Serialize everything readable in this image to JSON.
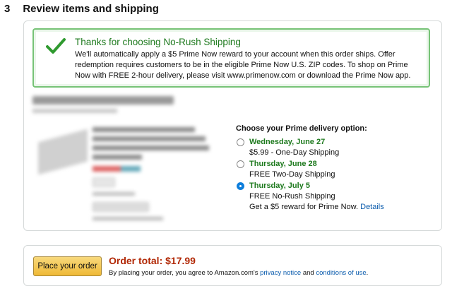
{
  "step": {
    "number": "3",
    "title": "Review items and shipping"
  },
  "alert": {
    "icon": "checkmark-icon",
    "title": "Thanks for choosing No-Rush Shipping",
    "body": "We'll automatically apply a $5 Prime Now reward to your account when this order ships. Offer redemption requires customers to be in the eligible Prime Now U.S. ZIP codes. To shop on Prime Now with FREE 2-hour delivery, please visit www.primenow.com or download the Prime Now app.",
    "border_color": "#77c377",
    "title_color": "#1e7a1e"
  },
  "delivery": {
    "title": "Choose your Prime delivery option:",
    "options": [
      {
        "date": "Wednesday, June 27",
        "detail": "$5.99 - One-Day Shipping",
        "selected": false
      },
      {
        "date": "Thursday, June 28",
        "detail": "FREE Two-Day Shipping",
        "selected": false
      },
      {
        "date": "Thursday, July 5",
        "detail": "FREE No-Rush Shipping",
        "extra": "Get a $5 reward for Prime Now.",
        "extra_link": "Details",
        "selected": true
      }
    ]
  },
  "order": {
    "button_label": "Place your order",
    "total_label": "Order total:",
    "total_value": "$17.99",
    "note_prefix": "By placing your order, you agree to Amazon.com's",
    "privacy_link": "privacy notice",
    "and_text": "and",
    "conditions_link": "conditions of use",
    "note_suffix": ".",
    "total_color": "#b12704",
    "button_color": "#efb936"
  },
  "colors": {
    "link": "#0b5cad",
    "radio_selected": "#0f7fdc"
  }
}
